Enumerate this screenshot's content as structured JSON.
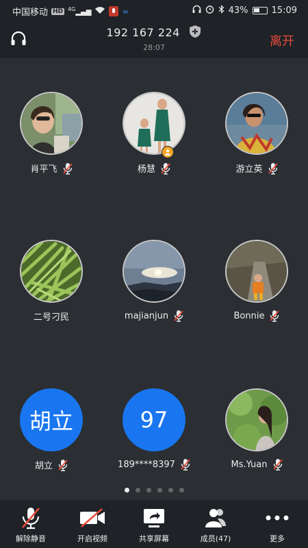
{
  "status_bar": {
    "carrier": "中国移动",
    "network": "HD",
    "signal": "4G",
    "battery": "43%",
    "time": "15:09"
  },
  "header": {
    "meeting_id": "192 167 224",
    "elapsed": "28:07",
    "leave_label": "离开"
  },
  "participants": [
    {
      "name": "肖平飞",
      "muted": true,
      "avatar": "photo"
    },
    {
      "name": "杨慧",
      "muted": true,
      "avatar": "photo",
      "host": true
    },
    {
      "name": "游立英",
      "muted": true,
      "avatar": "photo"
    },
    {
      "name": "二号刁民",
      "muted": false,
      "avatar": "photo"
    },
    {
      "name": "majianjun",
      "muted": true,
      "avatar": "photo"
    },
    {
      "name": "Bonnie",
      "muted": true,
      "avatar": "photo"
    },
    {
      "name": "胡立",
      "muted": true,
      "avatar_text": "胡立"
    },
    {
      "name": "189****8397",
      "muted": true,
      "avatar_text": "97"
    },
    {
      "name": "Ms.Yuan",
      "muted": true,
      "avatar": "photo"
    }
  ],
  "pagination": {
    "pages": 6,
    "current": 1
  },
  "toolbar": {
    "unmute": "解除静音",
    "video": "开启视频",
    "share": "共享屏幕",
    "members": "成员(47)",
    "more": "更多"
  },
  "colors": {
    "accent_blue": "#1976f0",
    "leave_red": "#e74c3c",
    "background": "#2b2e33"
  }
}
